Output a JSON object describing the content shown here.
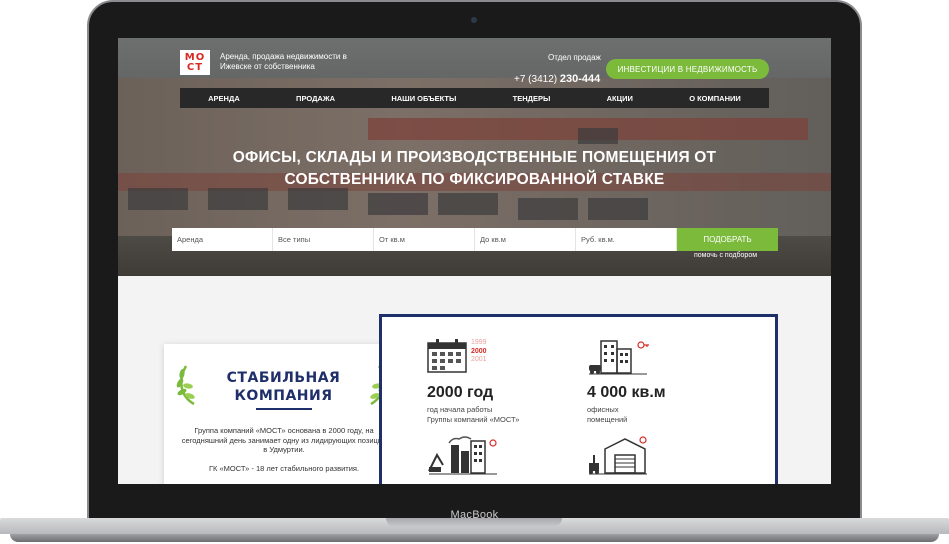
{
  "device": {
    "brand": "MacBook"
  },
  "header": {
    "logo": {
      "line1": "МО",
      "line2": "СТ"
    },
    "tagline": "Аренда, продажа недвижимости в Ижевске от собственника",
    "phone_label": "Отдел продаж",
    "phone_prefix": "+7 (3412)",
    "phone_number": "230-444",
    "invest_button": "ИНВЕСТИЦИИ В НЕДВИЖИМОСТЬ"
  },
  "nav": {
    "items": [
      "АРЕНДА",
      "ПРОДАЖА",
      "НАШИ ОБЪЕКТЫ",
      "ТЕНДЕРЫ",
      "АКЦИИ",
      "О КОМПАНИИ"
    ]
  },
  "hero": {
    "headline_line1": "ОФИСЫ, СКЛАДЫ И ПРОИЗВОДСТВЕННЫЕ ПОМЕЩЕНИЯ ОТ",
    "headline_line2": "СОБСТВЕННИКА ПО ФИКСИРОВАННОЙ СТАВКЕ"
  },
  "search": {
    "deal_type": "Аренда",
    "property_type": "Все типы",
    "area_from": "От кв.м",
    "area_to": "До кв.м",
    "price": "Руб. кв.м.",
    "submit": "ПОДОБРАТЬ",
    "helper": "помочь с подбором"
  },
  "company": {
    "title_line1": "СТАБИЛЬНАЯ",
    "title_line2": "КОМПАНИЯ",
    "text": "Группа компаний «МОСТ» основана в 2000 году, на сегодняшний день занимает одну из лидирующих позиций в Удмуртии.",
    "text2": "ГК «МОСТ» - 18 лет стабильного развития."
  },
  "stats": [
    {
      "years": [
        "1999",
        "2000",
        "2001"
      ],
      "value": "2000 год",
      "desc_line1": "год начала работы",
      "desc_line2": "Группы компаний «МОСТ»"
    },
    {
      "value": "4 000 кв.м",
      "desc_line1": "офисных",
      "desc_line2": "помещений"
    }
  ],
  "colors": {
    "green": "#7cba3c",
    "navy": "#1e2f6a",
    "red": "#d62b25"
  }
}
